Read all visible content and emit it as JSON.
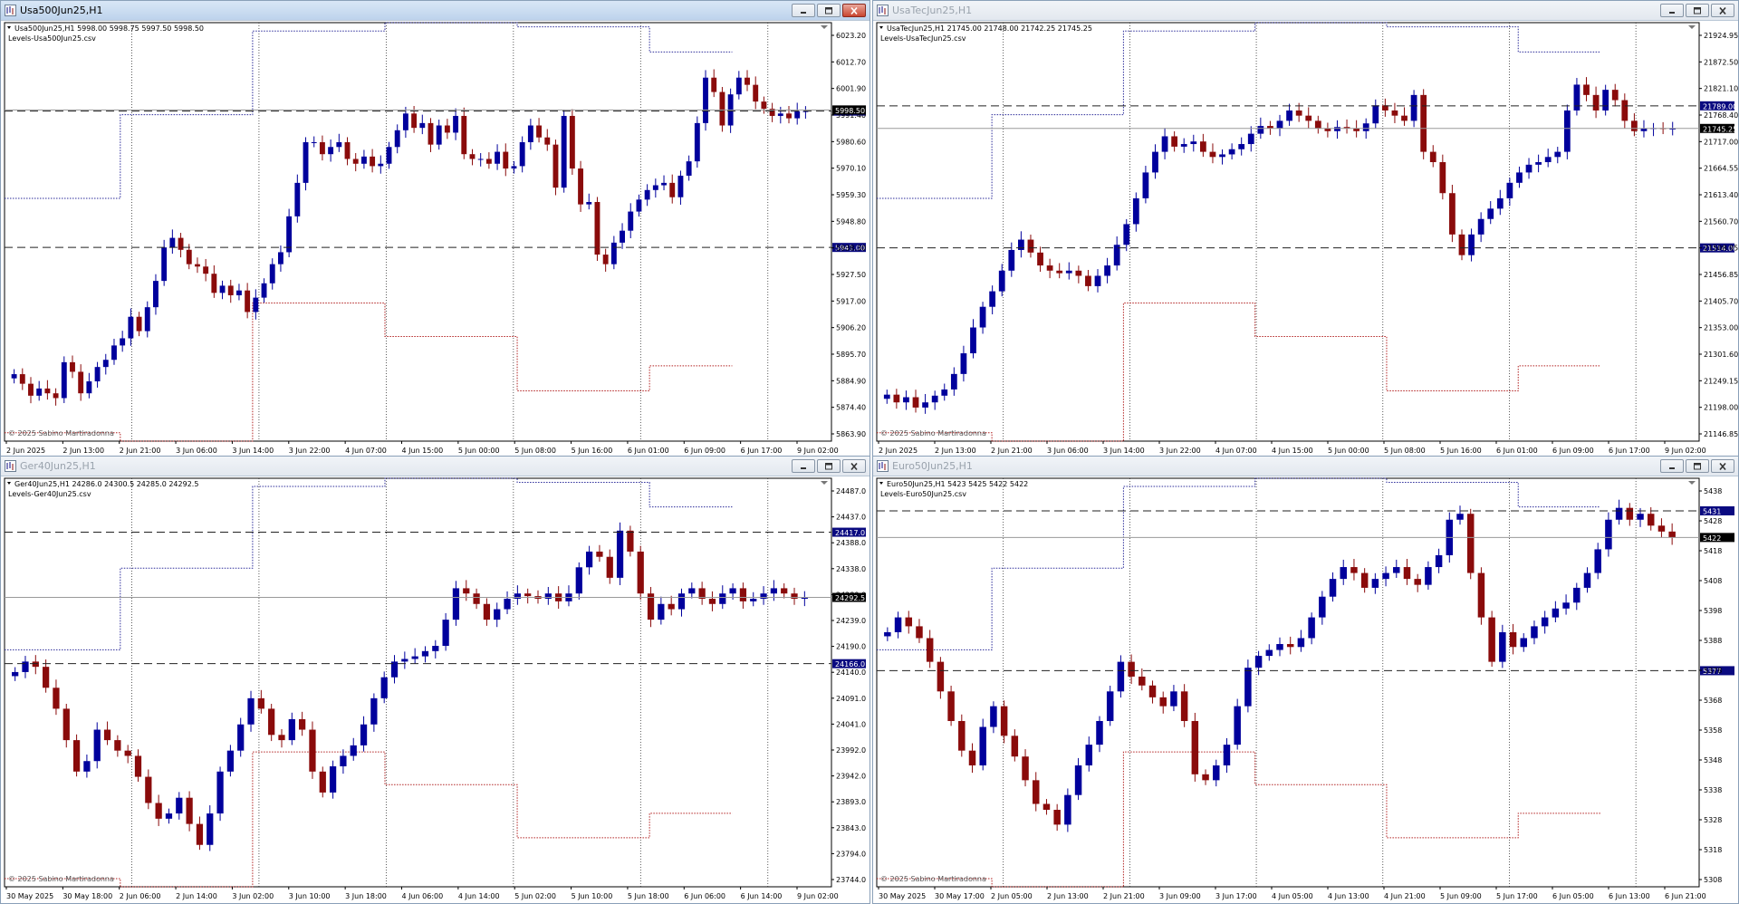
{
  "colors": {
    "bull": "#00009c",
    "bear": "#8a0b0b",
    "resistance": "#2b2b9a",
    "support": "#b22222",
    "tagLevel": "#0a0a80",
    "tagPrice": "#000000"
  },
  "windows": [
    {
      "title": "Usa500Jun25,H1",
      "active": true,
      "info": "Usa500Jun25,H1  5998.00 5998.75 5997.50 5998.50",
      "indicator": "Levels-Usa500Jun25.csv",
      "copyright": "© 2025 Sabino Martiradonna",
      "chart_data": {
        "type": "candlestick",
        "ylim": [
          5860,
          6035
        ],
        "price_ticks": [
          "6023.20",
          "6012.70",
          "6001.90",
          "5991.40",
          "5980.60",
          "5970.10",
          "5959.30",
          "5948.80",
          "5938.30",
          "5927.50",
          "5917.00",
          "5906.20",
          "5895.70",
          "5884.90",
          "5874.40",
          "5863.90"
        ],
        "time_labels": [
          "2 Jun 2025",
          "2 Jun 13:00",
          "2 Jun 21:00",
          "3 Jun 06:00",
          "3 Jun 14:00",
          "3 Jun 22:00",
          "4 Jun 07:00",
          "4 Jun 15:00",
          "5 Jun 00:00",
          "5 Jun 08:00",
          "5 Jun 16:00",
          "6 Jun 01:00",
          "6 Jun 09:00",
          "6 Jun 17:00",
          "9 Jun 02:00"
        ],
        "levels": [
          {
            "value": 5998.0,
            "label": "5998.00"
          },
          {
            "value": 5941.0,
            "label": "5941.00"
          }
        ],
        "current_price": 5998.5,
        "closes": [
          5888,
          5884,
          5879,
          5882,
          5880,
          5878,
          5893,
          5889,
          5880,
          5885,
          5891,
          5894,
          5900,
          5903,
          5912,
          5906,
          5916,
          5927,
          5941,
          5945,
          5940,
          5934,
          5933,
          5930,
          5922,
          5925,
          5921,
          5923,
          5914,
          5920,
          5926,
          5934,
          5939,
          5954,
          5968,
          5985,
          5985,
          5980,
          5983,
          5985,
          5978,
          5976,
          5979,
          5975,
          5976,
          5983,
          5990,
          5997,
          5991,
          5993,
          5984,
          5992,
          5989,
          5996,
          5980,
          5978,
          5978,
          5976,
          5981,
          5974,
          5975,
          5985,
          5992,
          5987,
          5984,
          5966,
          5996,
          5974,
          5959,
          5960,
          5938,
          5934,
          5943,
          5948,
          5956,
          5961,
          5965,
          5967,
          5968,
          5962,
          5971,
          5977,
          5993,
          6012,
          6006,
          5992,
          6005,
          6012,
          6009,
          6002,
          5999,
          5996,
          5997,
          5995,
          5998,
          5998
        ],
        "resistance_steps": [
          {
            "x": 0.0,
            "v": 5964
          },
          {
            "x": 0.13,
            "v": 5997
          },
          {
            "x": 0.31,
            "v": 6028
          },
          {
            "x": 0.48,
            "v": 6037
          },
          {
            "x": 0.66,
            "v": 6036
          }
        ],
        "support_steps": [
          {
            "x": 0.0,
            "v": 5863
          },
          {
            "x": 0.31,
            "v": 5919
          },
          {
            "x": 0.48,
            "v": 5905
          },
          {
            "x": 0.66,
            "v": 5885
          }
        ]
      }
    },
    {
      "title": "UsaTecJun25,H1",
      "active": false,
      "info": "UsaTecJun25,H1  21745.00 21748.00 21742.25 21745.25",
      "indicator": "Levels-UsaTecJun25.csv",
      "copyright": "© 2025 Sabino Martiradonna",
      "chart_data": {
        "type": "candlestick",
        "ylim": [
          21140,
          21950
        ],
        "price_ticks": [
          "21924.95",
          "21872.50",
          "21821.10",
          "21768.40",
          "21717.00",
          "21664.55",
          "21613.40",
          "21560.70",
          "21508.95",
          "21456.85",
          "21405.70",
          "21353.00",
          "21301.60",
          "21249.15",
          "21198.00",
          "21146.85"
        ],
        "time_labels": [
          "2 Jun 2025",
          "2 Jun 13:00",
          "2 Jun 21:00",
          "3 Jun 06:00",
          "3 Jun 14:00",
          "3 Jun 22:00",
          "4 Jun 07:00",
          "4 Jun 15:00",
          "5 Jun 00:00",
          "5 Jun 08:00",
          "5 Jun 16:00",
          "6 Jun 01:00",
          "6 Jun 09:00",
          "6 Jun 17:00",
          "9 Jun 02:00"
        ],
        "levels": [
          {
            "value": 21789.0,
            "label": "21789.00"
          },
          {
            "value": 21514.0,
            "label": "21514.00"
          }
        ],
        "current_price": 21745.25,
        "closes": [
          21230,
          21215,
          21225,
          21205,
          21215,
          21228,
          21240,
          21270,
          21310,
          21360,
          21400,
          21430,
          21470,
          21510,
          21530,
          21505,
          21480,
          21470,
          21465,
          21470,
          21460,
          21440,
          21460,
          21480,
          21520,
          21560,
          21610,
          21660,
          21700,
          21730,
          21710,
          21715,
          21720,
          21700,
          21690,
          21695,
          21705,
          21715,
          21735,
          21750,
          21745,
          21760,
          21780,
          21770,
          21760,
          21745,
          21740,
          21748,
          21745,
          21740,
          21755,
          21790,
          21780,
          21770,
          21760,
          21810,
          21700,
          21680,
          21620,
          21540,
          21500,
          21540,
          21570,
          21590,
          21610,
          21640,
          21660,
          21675,
          21680,
          21690,
          21700,
          21780,
          21830,
          21810,
          21780,
          21820,
          21800,
          21760,
          21740,
          21745,
          21746,
          21744,
          21745
        ]
      }
    },
    {
      "title": "Ger40Jun25,H1",
      "active": false,
      "info": "Ger40Jun25,H1  24286.0 24300.5 24285.0 24292.5",
      "indicator": "Levels-Ger40Jun25.csv",
      "copyright": "© 2025 Sabino Martiradonna",
      "chart_data": {
        "type": "candlestick",
        "ylim": [
          23740,
          24520
        ],
        "price_ticks": [
          "24487.0",
          "24437.0",
          "24388.0",
          "24338.0",
          "24289.0",
          "24239.0",
          "24190.0",
          "24140.0",
          "24091.0",
          "24041.0",
          "23992.0",
          "23942.0",
          "23893.0",
          "23843.0",
          "23794.0",
          "23744.0"
        ],
        "time_labels": [
          "30 May 2025",
          "30 May 18:00",
          "2 Jun 06:00",
          "2 Jun 14:00",
          "3 Jun 02:00",
          "3 Jun 10:00",
          "3 Jun 18:00",
          "4 Jun 06:00",
          "4 Jun 14:00",
          "5 Jun 02:00",
          "5 Jun 10:00",
          "5 Jun 18:00",
          "6 Jun 06:00",
          "6 Jun 14:00",
          "9 Jun 02:00"
        ],
        "levels": [
          {
            "value": 24417.0,
            "label": "24417.0"
          },
          {
            "value": 24166.0,
            "label": "24166.0"
          }
        ],
        "current_price": 24292.5,
        "closes": [
          24150,
          24170,
          24160,
          24120,
          24080,
          24020,
          23960,
          23980,
          24040,
          24020,
          24000,
          23990,
          23950,
          23900,
          23870,
          23880,
          23910,
          23860,
          23820,
          23880,
          23960,
          24000,
          24050,
          24100,
          24080,
          24030,
          24020,
          24060,
          24040,
          23960,
          23920,
          23970,
          23990,
          24010,
          24050,
          24100,
          24140,
          24170,
          24175,
          24180,
          24190,
          24200,
          24250,
          24310,
          24300,
          24280,
          24250,
          24270,
          24290,
          24300,
          24295,
          24290,
          24300,
          24285,
          24300,
          24350,
          24380,
          24370,
          24330,
          24420,
          24380,
          24300,
          24250,
          24280,
          24270,
          24300,
          24310,
          24290,
          24280,
          24300,
          24310,
          24285,
          24290,
          24300,
          24310,
          24300,
          24290,
          24292
        ]
      }
    },
    {
      "title": "Euro50Jun25,H1",
      "active": false,
      "info": "Euro50Jun25,H1  5423 5425 5422 5422",
      "indicator": "Levels-Euro50Jun25.csv",
      "copyright": "© 2025 Sabino Martiradonna",
      "chart_data": {
        "type": "candlestick",
        "ylim": [
          5304,
          5442
        ],
        "price_ticks": [
          "5438",
          "5428",
          "5418",
          "5408",
          "5398",
          "5388",
          "5378",
          "5368",
          "5358",
          "5348",
          "5338",
          "5328",
          "5318",
          "5308"
        ],
        "time_labels": [
          "30 May 2025",
          "30 May 17:00",
          "2 Jun 05:00",
          "2 Jun 13:00",
          "2 Jun 21:00",
          "3 Jun 09:00",
          "3 Jun 17:00",
          "4 Jun 05:00",
          "4 Jun 13:00",
          "4 Jun 21:00",
          "5 Jun 09:00",
          "5 Jun 17:00",
          "6 Jun 05:00",
          "6 Jun 13:00",
          "6 Jun 21:00"
        ],
        "levels": [
          {
            "value": 5431,
            "label": "5431"
          },
          {
            "value": 5377,
            "label": "5377"
          }
        ],
        "current_price": 5422,
        "closes": [
          5390,
          5395,
          5392,
          5388,
          5380,
          5370,
          5360,
          5350,
          5345,
          5358,
          5365,
          5355,
          5348,
          5340,
          5332,
          5330,
          5325,
          5335,
          5345,
          5352,
          5360,
          5370,
          5380,
          5375,
          5372,
          5368,
          5365,
          5370,
          5360,
          5342,
          5340,
          5345,
          5352,
          5365,
          5378,
          5382,
          5384,
          5386,
          5385,
          5388,
          5395,
          5402,
          5408,
          5412,
          5410,
          5405,
          5408,
          5410,
          5412,
          5408,
          5406,
          5412,
          5416,
          5428,
          5430,
          5410,
          5395,
          5380,
          5390,
          5385,
          5388,
          5392,
          5395,
          5398,
          5400,
          5405,
          5410,
          5418,
          5428,
          5432,
          5428,
          5430,
          5426,
          5424,
          5422
        ]
      }
    }
  ]
}
